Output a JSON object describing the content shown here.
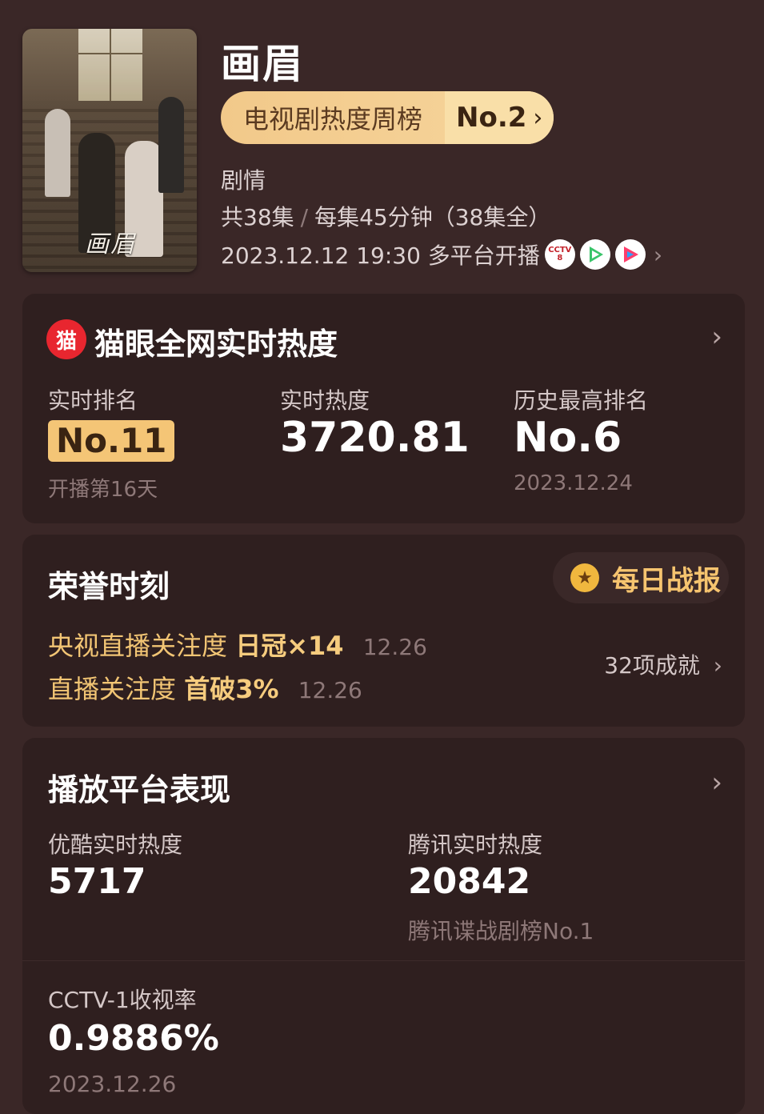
{
  "header": {
    "poster_title": "画眉",
    "title": "画眉",
    "rank_label": "电视剧热度周榜",
    "rank_value": "No.2",
    "rank_chevron": "›",
    "genre": "剧情",
    "episodes_total": "共38集",
    "episodes_sep": "/",
    "episodes_detail": "每集45分钟（38集全）",
    "air_info": "2023.12.12 19:30 多平台开播",
    "platform_icons": [
      "cctv8-icon",
      "iqiyi-play-icon",
      "tencent-video-icon"
    ],
    "cctv_icon_text": "CCTV 8",
    "air_chevron": "›"
  },
  "maoyan": {
    "logo_text": "猫",
    "title": "猫眼全网实时热度",
    "chevron": "›",
    "realtime_rank_label": "实时排名",
    "realtime_rank_value": "No.11",
    "realtime_rank_sub": "开播第16天",
    "heat_label": "实时热度",
    "heat_value": "3720.81",
    "best_rank_label": "历史最高排名",
    "best_rank_value": "No.6",
    "best_rank_date": "2023.12.24"
  },
  "honor": {
    "title": "荣誉时刻",
    "daily_button": "每日战报",
    "medal_glyph": "★",
    "items": [
      {
        "prefix": "央视直播关注度",
        "highlight": "日冠×14",
        "date": "12.26"
      },
      {
        "prefix": "直播关注度",
        "highlight": "首破3%",
        "date": "12.26"
      }
    ],
    "achievements": "32项成就",
    "achievements_chevron": "›"
  },
  "platforms": {
    "title": "播放平台表现",
    "chevron": "›",
    "youku_label": "优酷实时热度",
    "youku_value": "5717",
    "tencent_label": "腾讯实时热度",
    "tencent_value": "20842",
    "tencent_sub": "腾讯谍战剧榜No.1",
    "cctv_label": "CCTV-1收视率",
    "cctv_value": "0.9886%",
    "cctv_date": "2023.12.26"
  },
  "colors": {
    "background": "#3a2727",
    "card": "#2f1f1f",
    "accent_gold": "#f4c576",
    "maoyan_red": "#e8262f"
  }
}
